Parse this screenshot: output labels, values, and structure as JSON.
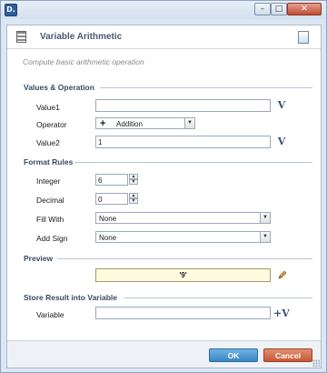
{
  "window": {
    "app_icon_letter": "D."
  },
  "window_controls": {
    "minimize": "–",
    "maximize": "□",
    "close": "✕"
  },
  "header": {
    "title": "Variable Arithmetic",
    "icon": "calculator-icon",
    "help_icon": "notes-icon"
  },
  "subtitle": "Compute basic arithmetic operation",
  "sections": {
    "values": "Values & Operation",
    "format": "Format Rules",
    "preview": "Preview",
    "store": "Store Result into Variable"
  },
  "values": {
    "value1_label": "Value1",
    "value1": "",
    "operator_label": "Operator",
    "operator_symbol": "+",
    "operator": "Addition",
    "value2_label": "Value2",
    "value2": "1",
    "variable_button": "V"
  },
  "format": {
    "integer_label": "Integer",
    "integer": "6",
    "decimal_label": "Decimal",
    "decimal": "0",
    "fill_label": "Fill With",
    "fill": "None",
    "sign_label": "Add Sign",
    "sign": "None"
  },
  "preview": {
    "value": "'9'"
  },
  "store": {
    "variable_label": "Variable",
    "variable": "",
    "assign_button": "+V"
  },
  "buttons": {
    "ok": "OK",
    "cancel": "Cancel"
  }
}
